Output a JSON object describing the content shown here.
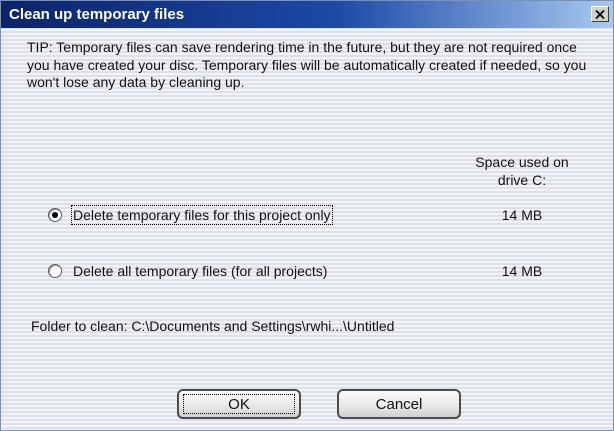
{
  "window": {
    "title": "Clean up temporary files",
    "close_icon": "close-icon"
  },
  "tip": "TIP: Temporary files can save rendering time in the future, but they are not required once you have created your disc. Temporary files will be automatically created if needed, so you won't lose any data by cleaning up.",
  "space_header": {
    "line1": "Space used on",
    "line2": "drive C:"
  },
  "options": [
    {
      "label": "Delete temporary files for this project only",
      "size": "14 MB",
      "selected": true
    },
    {
      "label": "Delete all temporary files (for all projects)",
      "size": "14 MB",
      "selected": false
    }
  ],
  "folder": "Folder to clean: C:\\Documents and Settings\\rwhi...\\Untitled",
  "buttons": {
    "ok": "OK",
    "cancel": "Cancel"
  },
  "colors": {
    "titlebar_start": "#0a246a",
    "titlebar_end": "#a6caf0",
    "background_stripe_light": "#f1f3f6",
    "background_stripe_dark": "#dde1e7"
  }
}
